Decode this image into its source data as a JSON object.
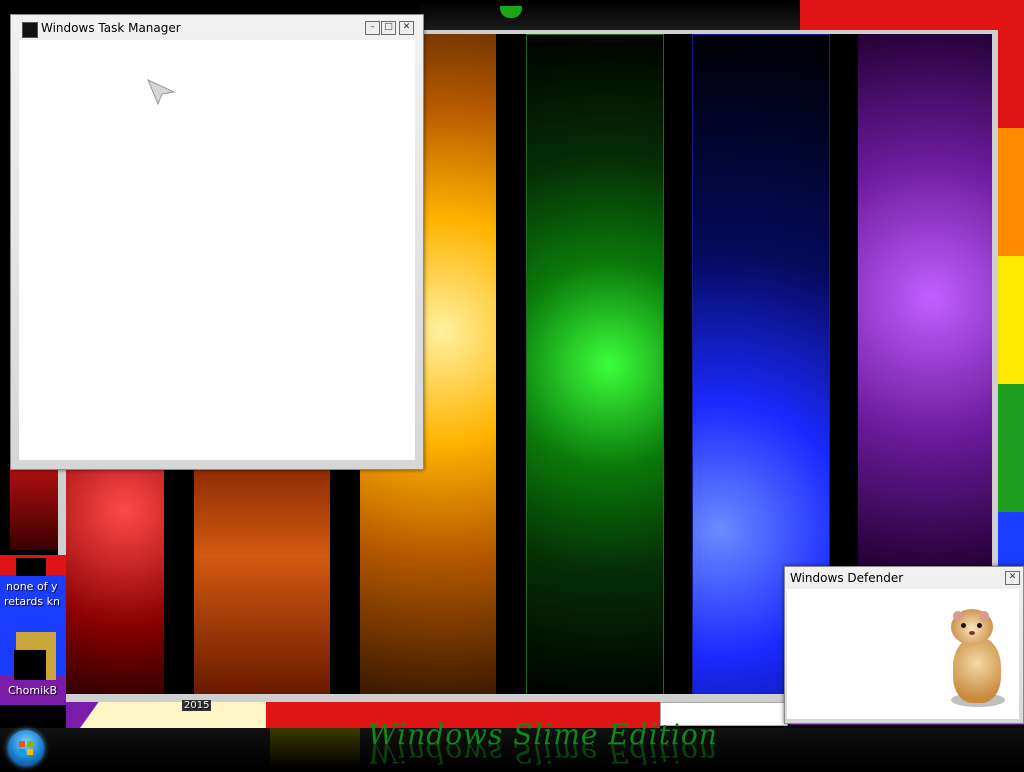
{
  "task_manager": {
    "title": "Windows Task Manager",
    "icon": "task-manager-icon"
  },
  "defender": {
    "title": "Windows Defender",
    "icon": "hamster-image"
  },
  "desktop": {
    "icons": [
      {
        "label_line1": "none of y",
        "label_line2": "retards kn"
      },
      {
        "label": "ChomikB"
      }
    ],
    "year_label": "2015",
    "edition_text": "Windows Slime Edition"
  },
  "taskbar": {
    "start": "start-orb"
  },
  "colors": {
    "red": "#e01414",
    "orange": "#ff8a00",
    "yellow": "#ffe800",
    "green": "#1e9e1e",
    "blue": "#1a3cff",
    "purple": "#7a1ca8"
  }
}
